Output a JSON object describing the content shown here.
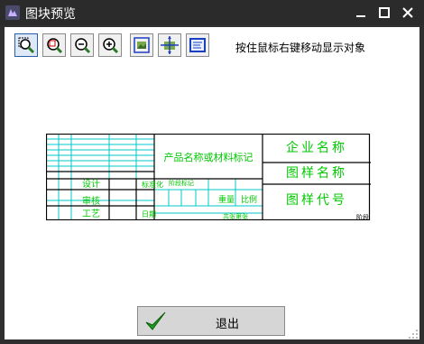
{
  "window": {
    "title": "图块预览",
    "controls": {
      "minimize": "minimize",
      "maximize": "maximize",
      "close": "close"
    }
  },
  "toolbar": {
    "buttons": [
      {
        "name": "zoom-window",
        "icon": "zoom-window-icon"
      },
      {
        "name": "zoom-previous",
        "icon": "zoom-previous-icon"
      },
      {
        "name": "zoom-out",
        "icon": "zoom-out-icon"
      },
      {
        "name": "zoom-in",
        "icon": "zoom-in-icon"
      },
      {
        "name": "zoom-extents",
        "icon": "zoom-extents-icon"
      },
      {
        "name": "pan",
        "icon": "pan-icon"
      },
      {
        "name": "display-settings",
        "icon": "display-icon"
      }
    ],
    "hint": "按住鼠标右键移动显示对象"
  },
  "drawing": {
    "product_label": "产品名称或材料标记",
    "company": "企业名称",
    "drawing_name": "图样名称",
    "drawing_code": "图样代号",
    "design": "设计",
    "review": "审核",
    "process": "工艺",
    "standardize": "标准化",
    "approve": "日期",
    "weight": "重量",
    "scale": "比例",
    "stage_mark": "阶段标记",
    "sheets": "共张第张",
    "corner_mark": "阶段"
  },
  "colors": {
    "title_text": "#ffffff",
    "frame": "#000000",
    "grid": "#00c8c8",
    "label_green": "#00c800",
    "check_green": "#1a9e1a"
  },
  "footer": {
    "exit_label": "退出"
  }
}
